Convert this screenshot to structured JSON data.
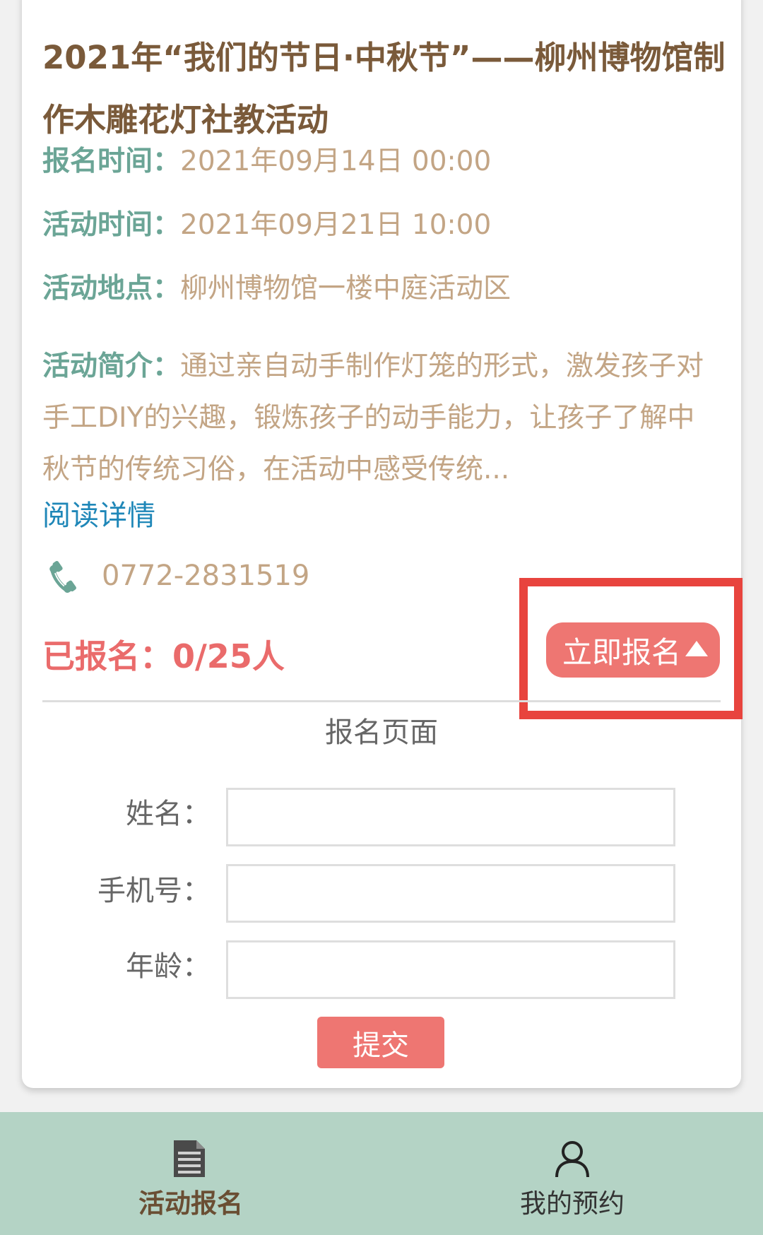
{
  "activity": {
    "title": "2021年“我们的节日·中秋节”——柳州博物馆制作木雕花灯社教活动",
    "signup_time_label": "报名时间：",
    "signup_time": "2021年09月14日 00:00",
    "activity_time_label": "活动时间：",
    "activity_time": "2021年09月21日 10:00",
    "location_label": "活动地点：",
    "location": "柳州博物馆一楼中庭活动区",
    "intro_label": "活动简介：",
    "intro": "通过亲自动手制作灯笼的形式，激发孩子对手工DIY的兴趣，锻炼孩子的动手能力，让孩子了解中秋节的传统习俗，在活动中感受传统...",
    "read_more": "阅读详情",
    "phone": "0772-2831519",
    "phone_icon": "phone-icon",
    "signed_count": "已报名：0/25人",
    "signup_button": "立即报名"
  },
  "form": {
    "title": "报名页面",
    "name_label": "姓名：",
    "name_value": "",
    "phone_label": "手机号：",
    "phone_value": "",
    "age_label": "年龄：",
    "age_value": "",
    "submit": "提交"
  },
  "nav": {
    "items": [
      {
        "label": "活动报名",
        "icon": "document-icon",
        "active": true
      },
      {
        "label": "我的预约",
        "icon": "user-icon",
        "active": false
      }
    ]
  },
  "colors": {
    "title_brown": "#7a5a3a",
    "label_green": "#6ba596",
    "value_tan": "#c3a585",
    "link_blue": "#1f87b8",
    "accent_red": "#ee7672",
    "highlight_red": "#e8443e",
    "nav_bg": "#b4d3c5"
  }
}
